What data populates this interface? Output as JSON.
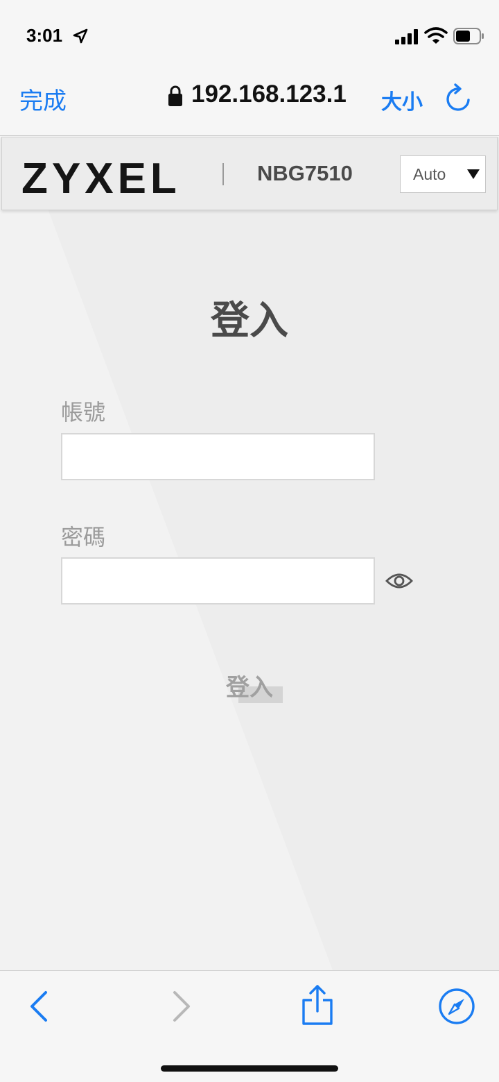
{
  "status_bar": {
    "time": "3:01"
  },
  "safari": {
    "done_label": "完成",
    "url": "192.168.123.1",
    "text_size_label": "大小"
  },
  "router": {
    "brand": "ZYXEL",
    "model": "NBG7510",
    "language_selected": "Auto"
  },
  "login": {
    "title": "登入",
    "username_label": "帳號",
    "password_label": "密碼",
    "username_value": "",
    "password_value": "",
    "submit_label": "登入"
  },
  "colors": {
    "ios_blue": "#1a7cf2",
    "page_bg": "#ededed",
    "title_text": "#4a4a4a",
    "muted_text": "#9b9b9b"
  },
  "icons": {
    "location": "location-arrow-icon",
    "signal": "cellular-signal-icon",
    "wifi": "wifi-icon",
    "battery": "battery-icon",
    "lock": "lock-icon",
    "reload": "reload-icon",
    "eye": "eye-icon",
    "back": "chevron-left-icon",
    "forward": "chevron-right-icon",
    "share": "share-icon",
    "compass": "compass-icon"
  }
}
